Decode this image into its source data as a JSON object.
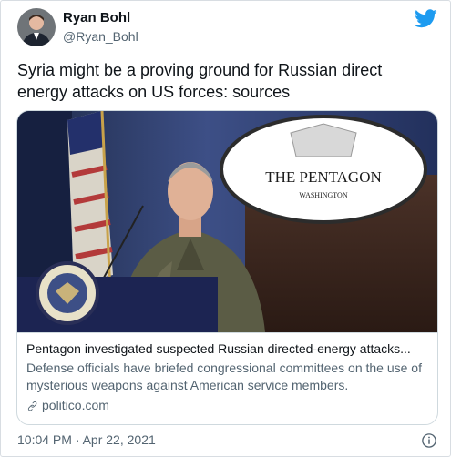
{
  "author": {
    "display_name": "Ryan Bohl",
    "handle": "@Ryan_Bohl"
  },
  "tweet": {
    "text": "Syria might be a proving ground for Russian direct energy attacks on US forces: sources",
    "timestamp": "10:04 PM · Apr 22, 2021"
  },
  "card": {
    "title": "Pentagon investigated suspected Russian directed-energy attacks...",
    "description": "Defense officials have briefed congressional committees on the use of mysterious weapons against American service members.",
    "domain": "politico.com",
    "image": {
      "sign_title": "THE PENTAGON",
      "sign_subtitle": "WASHINGTON"
    }
  },
  "colors": {
    "twitter_blue": "#1d9bf0",
    "text_primary": "#0f1419",
    "text_secondary": "#536471",
    "border": "#cfd9de"
  },
  "icons": {
    "brand": "twitter-bird-icon",
    "link": "link-icon",
    "info": "info-icon"
  }
}
